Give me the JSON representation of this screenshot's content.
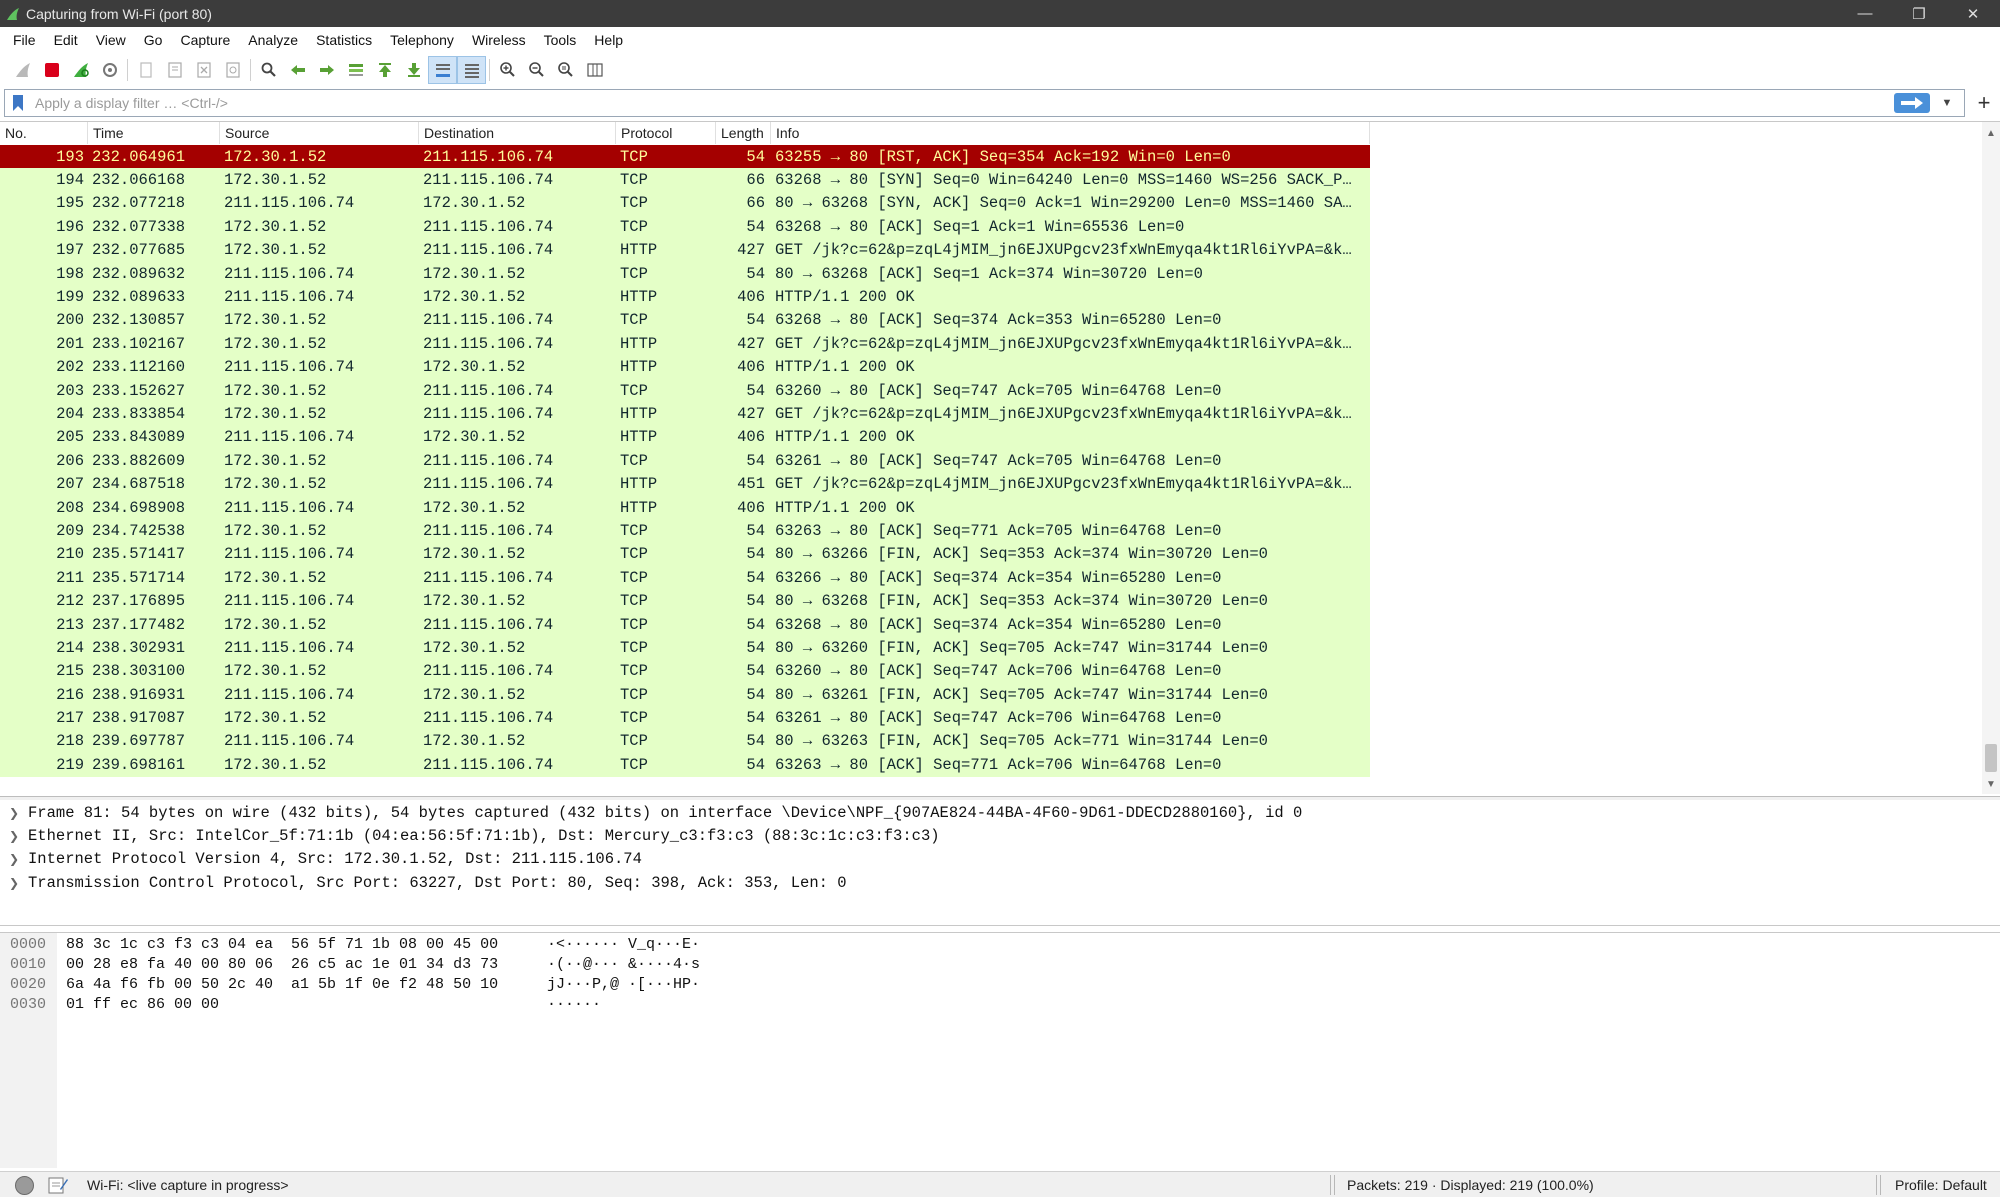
{
  "window": {
    "title": "Capturing from Wi-Fi (port 80)",
    "controls": [
      "minimize-icon",
      "restore-icon",
      "close-icon"
    ]
  },
  "menu": [
    "File",
    "Edit",
    "View",
    "Go",
    "Capture",
    "Analyze",
    "Statistics",
    "Telephony",
    "Wireless",
    "Tools",
    "Help"
  ],
  "toolbar": {
    "icons": [
      "shark-fin-start-icon",
      "stop-capture-icon",
      "restart-capture-icon",
      "capture-options-icon",
      "open-file-icon",
      "save-file-icon",
      "close-file-icon",
      "reload-file-icon",
      "find-packet-icon",
      "go-back-icon",
      "go-forward-icon",
      "go-to-packet-icon",
      "go-first-icon",
      "go-last-icon",
      "autoscroll-icon",
      "colorize-icon",
      "zoom-in-icon",
      "zoom-out-icon",
      "normal-size-icon",
      "resize-columns-icon"
    ]
  },
  "filter": {
    "placeholder": "Apply a display filter … <Ctrl-/>"
  },
  "columns": [
    "No.",
    "Time",
    "Source",
    "Destination",
    "Protocol",
    "Length",
    "Info"
  ],
  "packets": [
    {
      "no": "193",
      "time": "232.064961",
      "src": "172.30.1.52",
      "dst": "211.115.106.74",
      "proto": "TCP",
      "len": "54",
      "info": "63255 → 80 [RST, ACK] Seq=354 Ack=192 Win=0 Len=0"
    },
    {
      "no": "194",
      "time": "232.066168",
      "src": "172.30.1.52",
      "dst": "211.115.106.74",
      "proto": "TCP",
      "len": "66",
      "info": "63268 → 80 [SYN] Seq=0 Win=64240 Len=0 MSS=1460 WS=256 SACK_P…"
    },
    {
      "no": "195",
      "time": "232.077218",
      "src": "211.115.106.74",
      "dst": "172.30.1.52",
      "proto": "TCP",
      "len": "66",
      "info": "80 → 63268 [SYN, ACK] Seq=0 Ack=1 Win=29200 Len=0 MSS=1460 SA…"
    },
    {
      "no": "196",
      "time": "232.077338",
      "src": "172.30.1.52",
      "dst": "211.115.106.74",
      "proto": "TCP",
      "len": "54",
      "info": "63268 → 80 [ACK] Seq=1 Ack=1 Win=65536 Len=0"
    },
    {
      "no": "197",
      "time": "232.077685",
      "src": "172.30.1.52",
      "dst": "211.115.106.74",
      "proto": "HTTP",
      "len": "427",
      "info": "GET /jk?c=62&p=zqL4jMIM_jn6EJXUPgcv23fxWnEmyqa4kt1Rl6iYvPA=&k…"
    },
    {
      "no": "198",
      "time": "232.089632",
      "src": "211.115.106.74",
      "dst": "172.30.1.52",
      "proto": "TCP",
      "len": "54",
      "info": "80 → 63268 [ACK] Seq=1 Ack=374 Win=30720 Len=0"
    },
    {
      "no": "199",
      "time": "232.089633",
      "src": "211.115.106.74",
      "dst": "172.30.1.52",
      "proto": "HTTP",
      "len": "406",
      "info": "HTTP/1.1 200 OK"
    },
    {
      "no": "200",
      "time": "232.130857",
      "src": "172.30.1.52",
      "dst": "211.115.106.74",
      "proto": "TCP",
      "len": "54",
      "info": "63268 → 80 [ACK] Seq=374 Ack=353 Win=65280 Len=0"
    },
    {
      "no": "201",
      "time": "233.102167",
      "src": "172.30.1.52",
      "dst": "211.115.106.74",
      "proto": "HTTP",
      "len": "427",
      "info": "GET /jk?c=62&p=zqL4jMIM_jn6EJXUPgcv23fxWnEmyqa4kt1Rl6iYvPA=&k…"
    },
    {
      "no": "202",
      "time": "233.112160",
      "src": "211.115.106.74",
      "dst": "172.30.1.52",
      "proto": "HTTP",
      "len": "406",
      "info": "HTTP/1.1 200 OK"
    },
    {
      "no": "203",
      "time": "233.152627",
      "src": "172.30.1.52",
      "dst": "211.115.106.74",
      "proto": "TCP",
      "len": "54",
      "info": "63260 → 80 [ACK] Seq=747 Ack=705 Win=64768 Len=0"
    },
    {
      "no": "204",
      "time": "233.833854",
      "src": "172.30.1.52",
      "dst": "211.115.106.74",
      "proto": "HTTP",
      "len": "427",
      "info": "GET /jk?c=62&p=zqL4jMIM_jn6EJXUPgcv23fxWnEmyqa4kt1Rl6iYvPA=&k…"
    },
    {
      "no": "205",
      "time": "233.843089",
      "src": "211.115.106.74",
      "dst": "172.30.1.52",
      "proto": "HTTP",
      "len": "406",
      "info": "HTTP/1.1 200 OK"
    },
    {
      "no": "206",
      "time": "233.882609",
      "src": "172.30.1.52",
      "dst": "211.115.106.74",
      "proto": "TCP",
      "len": "54",
      "info": "63261 → 80 [ACK] Seq=747 Ack=705 Win=64768 Len=0"
    },
    {
      "no": "207",
      "time": "234.687518",
      "src": "172.30.1.52",
      "dst": "211.115.106.74",
      "proto": "HTTP",
      "len": "451",
      "info": "GET /jk?c=62&p=zqL4jMIM_jn6EJXUPgcv23fxWnEmyqa4kt1Rl6iYvPA=&k…"
    },
    {
      "no": "208",
      "time": "234.698908",
      "src": "211.115.106.74",
      "dst": "172.30.1.52",
      "proto": "HTTP",
      "len": "406",
      "info": "HTTP/1.1 200 OK"
    },
    {
      "no": "209",
      "time": "234.742538",
      "src": "172.30.1.52",
      "dst": "211.115.106.74",
      "proto": "TCP",
      "len": "54",
      "info": "63263 → 80 [ACK] Seq=771 Ack=705 Win=64768 Len=0"
    },
    {
      "no": "210",
      "time": "235.571417",
      "src": "211.115.106.74",
      "dst": "172.30.1.52",
      "proto": "TCP",
      "len": "54",
      "info": "80 → 63266 [FIN, ACK] Seq=353 Ack=374 Win=30720 Len=0"
    },
    {
      "no": "211",
      "time": "235.571714",
      "src": "172.30.1.52",
      "dst": "211.115.106.74",
      "proto": "TCP",
      "len": "54",
      "info": "63266 → 80 [ACK] Seq=374 Ack=354 Win=65280 Len=0"
    },
    {
      "no": "212",
      "time": "237.176895",
      "src": "211.115.106.74",
      "dst": "172.30.1.52",
      "proto": "TCP",
      "len": "54",
      "info": "80 → 63268 [FIN, ACK] Seq=353 Ack=374 Win=30720 Len=0"
    },
    {
      "no": "213",
      "time": "237.177482",
      "src": "172.30.1.52",
      "dst": "211.115.106.74",
      "proto": "TCP",
      "len": "54",
      "info": "63268 → 80 [ACK] Seq=374 Ack=354 Win=65280 Len=0"
    },
    {
      "no": "214",
      "time": "238.302931",
      "src": "211.115.106.74",
      "dst": "172.30.1.52",
      "proto": "TCP",
      "len": "54",
      "info": "80 → 63260 [FIN, ACK] Seq=705 Ack=747 Win=31744 Len=0"
    },
    {
      "no": "215",
      "time": "238.303100",
      "src": "172.30.1.52",
      "dst": "211.115.106.74",
      "proto": "TCP",
      "len": "54",
      "info": "63260 → 80 [ACK] Seq=747 Ack=706 Win=64768 Len=0"
    },
    {
      "no": "216",
      "time": "238.916931",
      "src": "211.115.106.74",
      "dst": "172.30.1.52",
      "proto": "TCP",
      "len": "54",
      "info": "80 → 63261 [FIN, ACK] Seq=705 Ack=747 Win=31744 Len=0"
    },
    {
      "no": "217",
      "time": "238.917087",
      "src": "172.30.1.52",
      "dst": "211.115.106.74",
      "proto": "TCP",
      "len": "54",
      "info": "63261 → 80 [ACK] Seq=747 Ack=706 Win=64768 Len=0"
    },
    {
      "no": "218",
      "time": "239.697787",
      "src": "211.115.106.74",
      "dst": "172.30.1.52",
      "proto": "TCP",
      "len": "54",
      "info": "80 → 63263 [FIN, ACK] Seq=705 Ack=771 Win=31744 Len=0"
    },
    {
      "no": "219",
      "time": "239.698161",
      "src": "172.30.1.52",
      "dst": "211.115.106.74",
      "proto": "TCP",
      "len": "54",
      "info": "63263 → 80 [ACK] Seq=771 Ack=706 Win=64768 Len=0"
    }
  ],
  "colors": {
    "row_tcp_http": "#e4ffc7",
    "row_selected": "#a40000",
    "row_selected_text": "#fffc9c",
    "titlebar": "#3c3c3c"
  },
  "details": [
    "Frame 81: 54 bytes on wire (432 bits), 54 bytes captured (432 bits) on interface \\Device\\NPF_{907AE824-44BA-4F60-9D61-DDECD2880160}, id 0",
    "Ethernet II, Src: IntelCor_5f:71:1b (04:ea:56:5f:71:1b), Dst: Mercury_c3:f3:c3 (88:3c:1c:c3:f3:c3)",
    "Internet Protocol Version 4, Src: 172.30.1.52, Dst: 211.115.106.74",
    "Transmission Control Protocol, Src Port: 63227, Dst Port: 80, Seq: 398, Ack: 353, Len: 0"
  ],
  "bytes": [
    {
      "offset": "0000",
      "hex": "88 3c 1c c3 f3 c3 04 ea  56 5f 71 1b 08 00 45 00",
      "ascii": "·<······ V_q···E·"
    },
    {
      "offset": "0010",
      "hex": "00 28 e8 fa 40 00 80 06  26 c5 ac 1e 01 34 d3 73",
      "ascii": "·(··@··· &····4·s"
    },
    {
      "offset": "0020",
      "hex": "6a 4a f6 fb 00 50 2c 40  a1 5b 1f 0e f2 48 50 10",
      "ascii": "jJ···P,@ ·[···HP·"
    },
    {
      "offset": "0030",
      "hex": "01 ff ec 86 00 00",
      "ascii": "······"
    }
  ],
  "status": {
    "capture_text": "Wi-Fi: <live capture in progress>",
    "packets_text": "Packets: 219 · Displayed: 219 (100.0%)",
    "profile_text": "Profile: Default"
  }
}
